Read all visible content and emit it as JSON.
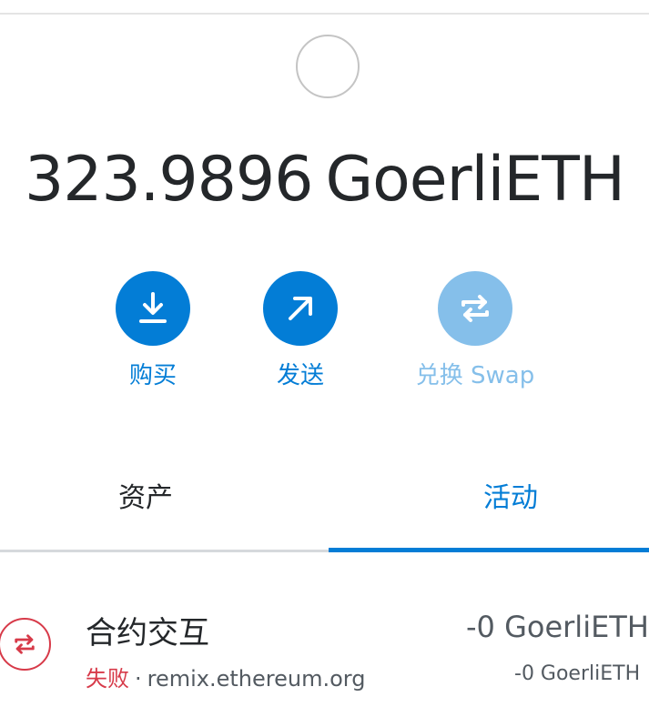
{
  "balance": {
    "amount": "323.9896",
    "currency": "GoerliETH"
  },
  "actions": {
    "buy": {
      "label": "购买",
      "icon": "download-icon"
    },
    "send": {
      "label": "发送",
      "icon": "arrow-up-right-icon"
    },
    "swap": {
      "label": "兑换 Swap",
      "icon": "swap-icon",
      "disabled": true
    }
  },
  "tabs": {
    "assets": "资产",
    "activity": "活动",
    "active": "activity"
  },
  "activity": {
    "items": [
      {
        "title": "合约交互",
        "status": "失败",
        "separator": "·",
        "origin": "remix.ethereum.org",
        "primary_amount": "-0 GoerliETH",
        "secondary_amount": "-0 GoerliETH",
        "icon": "swap-icon"
      }
    ]
  },
  "colors": {
    "primary": "#037dd6",
    "disabled": "#85bfea",
    "error": "#d73a49",
    "text": "#24272a",
    "muted": "#535a61"
  }
}
